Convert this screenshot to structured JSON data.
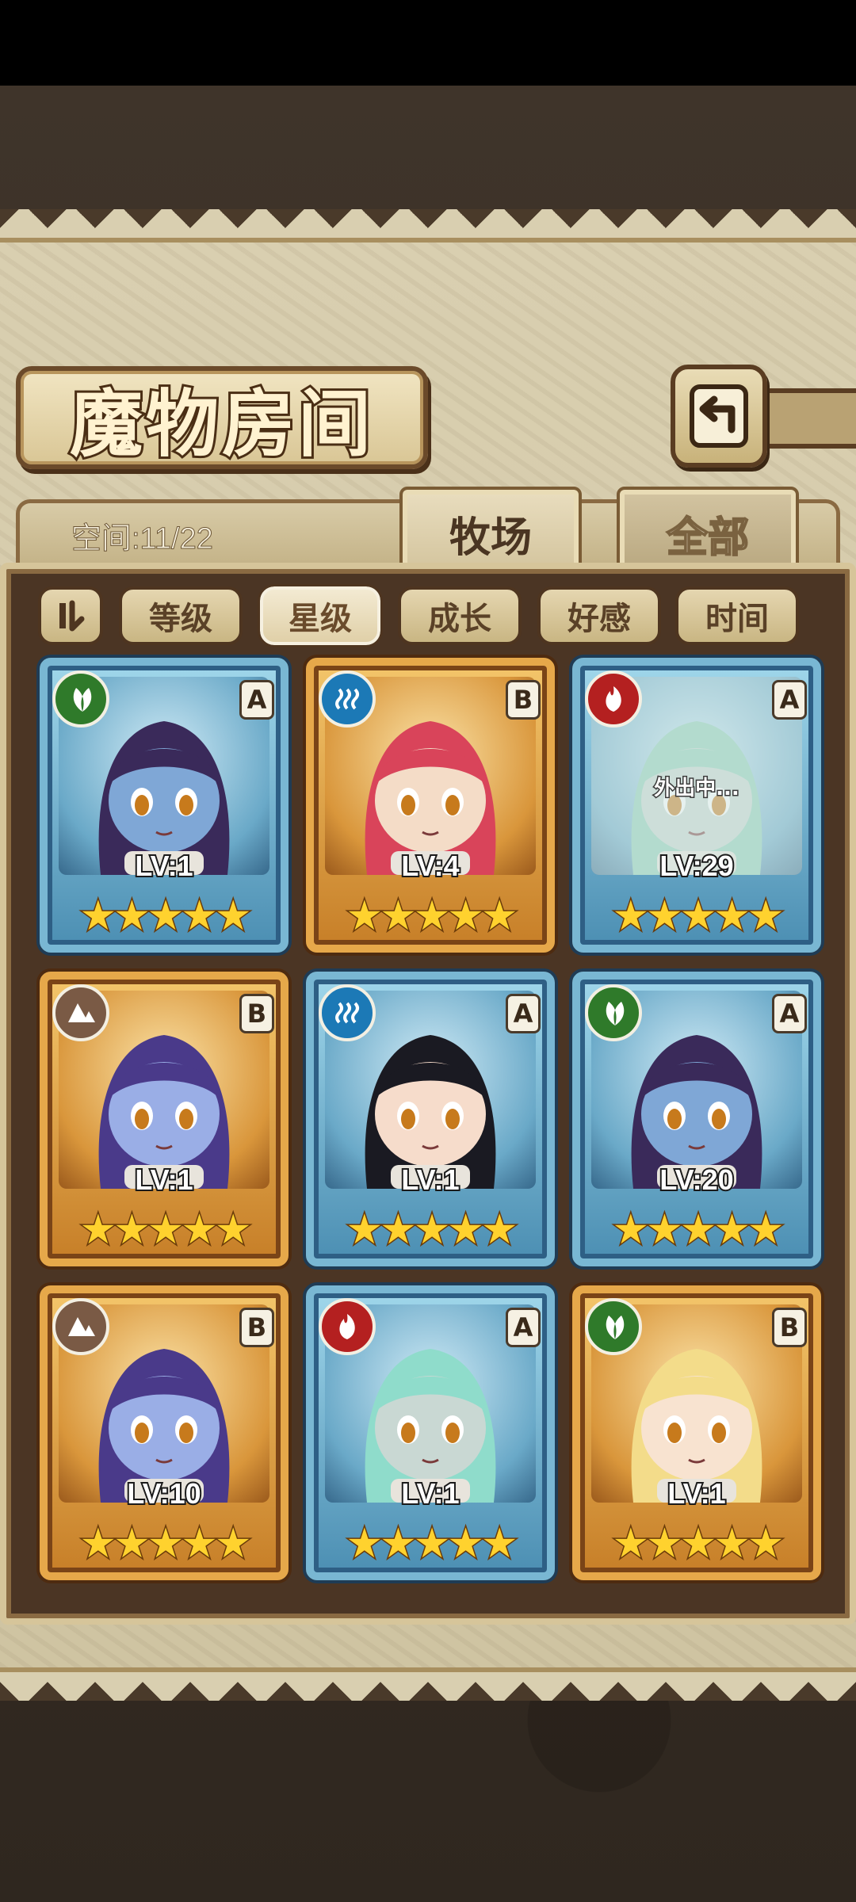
{
  "title": "魔物房间",
  "space_label": "空间:11/22",
  "tabs": [
    {
      "label": "牧场",
      "active": true
    },
    {
      "label": "全部",
      "active": false
    }
  ],
  "sort_options": [
    {
      "label": "等级",
      "active": false
    },
    {
      "label": "星级",
      "active": true
    },
    {
      "label": "成长",
      "active": false
    },
    {
      "label": "好感",
      "active": false
    },
    {
      "label": "时间",
      "active": false
    }
  ],
  "icons": {
    "back": "return-arrow-icon",
    "sort_toggle": "sort-order-icon",
    "grass": "leaf-icon",
    "water": "water-wave-icon",
    "fire": "flame-icon",
    "earth": "mountain-icon"
  },
  "stars_text": "★★★★★",
  "monsters": [
    {
      "frame": "blue",
      "element": "grass",
      "rank": "A",
      "level": "LV:1",
      "hair": "#3a2a5a",
      "skin": "#7fa7d6",
      "away": ""
    },
    {
      "frame": "gold",
      "element": "water",
      "rank": "B",
      "level": "LV:4",
      "hair": "#d9445a",
      "skin": "#f4dcc7",
      "away": ""
    },
    {
      "frame": "blue",
      "element": "fire",
      "rank": "A",
      "level": "LV:29",
      "hair": "#8fcfb7",
      "skin": "#c7d6cf",
      "away": "外出中..."
    },
    {
      "frame": "gold",
      "element": "earth",
      "rank": "B",
      "level": "LV:1",
      "hair": "#4a3a8a",
      "skin": "#9aaee6",
      "away": ""
    },
    {
      "frame": "blue",
      "element": "water",
      "rank": "A",
      "level": "LV:1",
      "hair": "#1a1a22",
      "skin": "#f6dccb",
      "away": ""
    },
    {
      "frame": "blue",
      "element": "grass",
      "rank": "A",
      "level": "LV:20",
      "hair": "#3a2a5a",
      "skin": "#7fa7d6",
      "away": ""
    },
    {
      "frame": "gold",
      "element": "earth",
      "rank": "B",
      "level": "LV:10",
      "hair": "#4a3a8a",
      "skin": "#9aaee6",
      "away": ""
    },
    {
      "frame": "blue",
      "element": "fire",
      "rank": "A",
      "level": "LV:1",
      "hair": "#8fdccb",
      "skin": "#c9d8d3",
      "away": ""
    },
    {
      "frame": "gold",
      "element": "grass",
      "rank": "B",
      "level": "LV:1",
      "hair": "#f3dc8a",
      "skin": "#f8e3d0",
      "away": ""
    }
  ]
}
